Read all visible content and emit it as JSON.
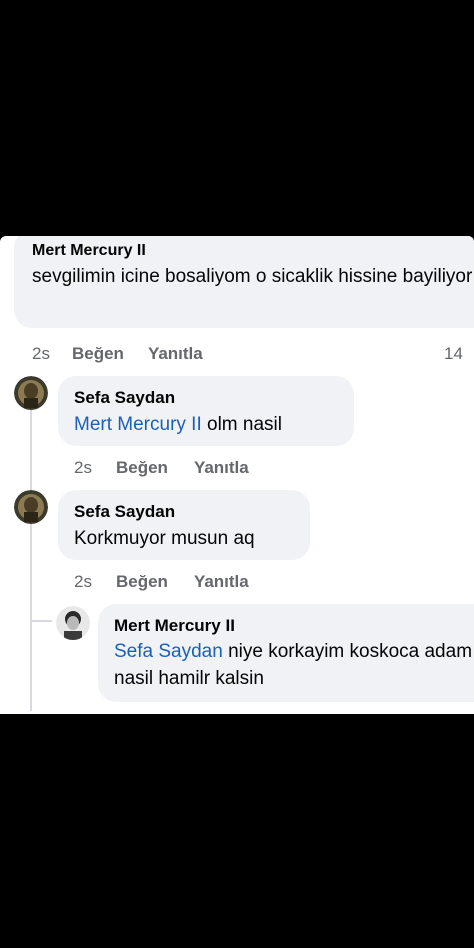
{
  "comments": [
    {
      "author": "Mert Mercury II",
      "text": "sevgilimin icine bosaliyom o sicaklik hissine bayiliyor",
      "time": "2s",
      "like": "Beğen",
      "reply": "Yanıtla",
      "reaction_count": "14"
    },
    {
      "author": "Sefa Saydan",
      "mention": "Mert Mercury II",
      "text": "olm nasil",
      "time": "2s",
      "like": "Beğen",
      "reply": "Yanıtla"
    },
    {
      "author": "Sefa Saydan",
      "text": "Korkmuyor musun aq",
      "time": "2s",
      "like": "Beğen",
      "reply": "Yanıtla"
    },
    {
      "author": "Mert Mercury II",
      "mention": "Sefa Saydan",
      "text": "niye korkayim koskoca adam nasil hamilr kalsin"
    }
  ],
  "colors": {
    "background": "#000000",
    "bubble": "#f0f2f5",
    "mention": "#1b5fb7",
    "meta": "#65676b"
  }
}
